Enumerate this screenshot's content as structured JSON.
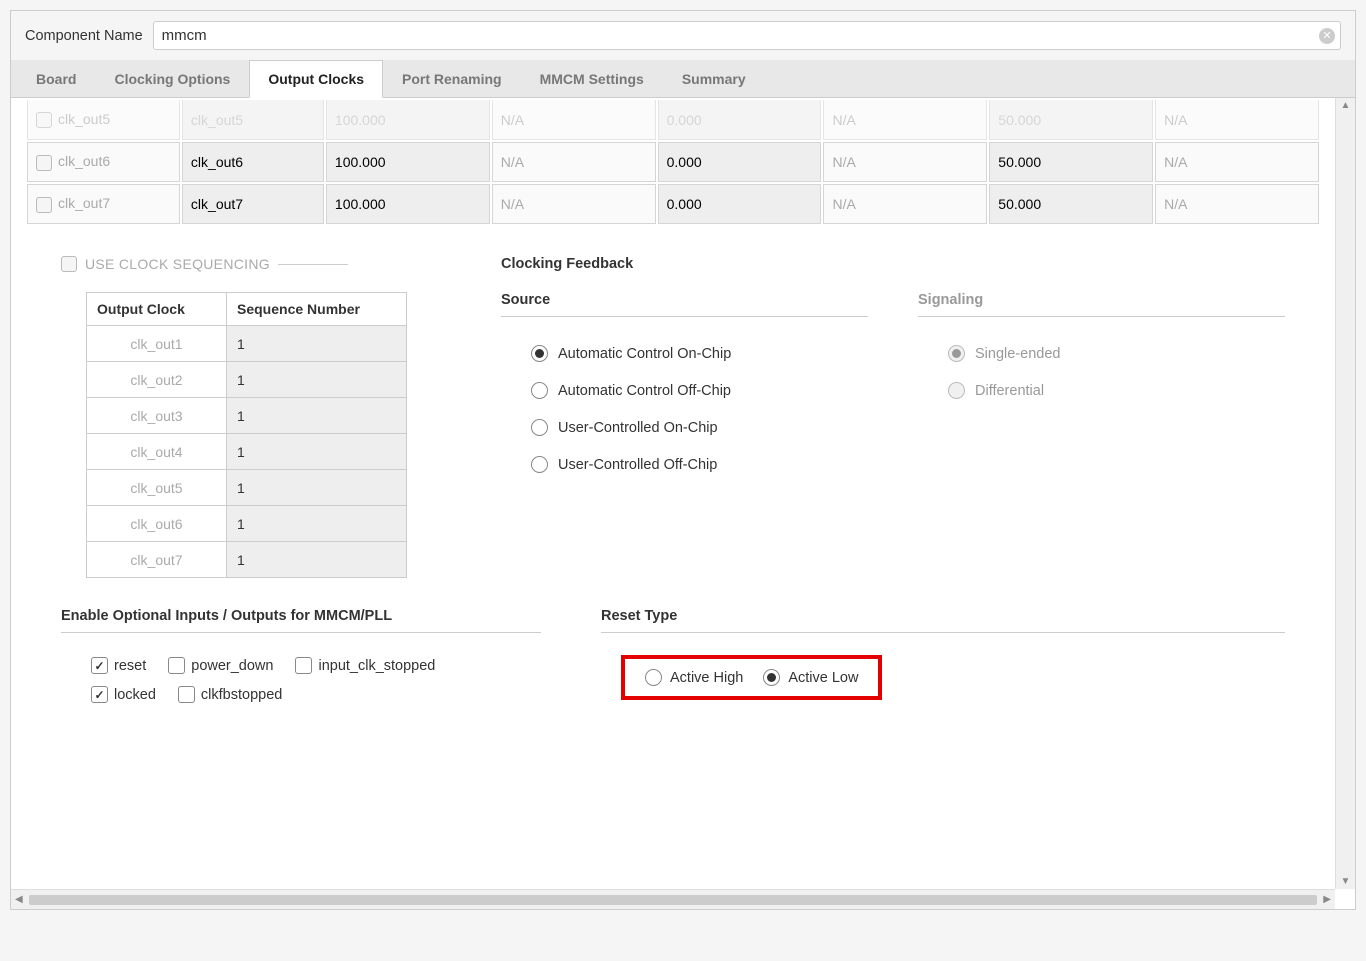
{
  "componentNameLabel": "Component Name",
  "componentName": "mmcm",
  "tabs": [
    "Board",
    "Clocking Options",
    "Output Clocks",
    "Port Renaming",
    "MMCM Settings",
    "Summary"
  ],
  "activeTabIndex": 2,
  "clockRows": [
    {
      "enabled": false,
      "nameLabel": "clk_out5",
      "portName": "clk_out5",
      "freq": "100.000",
      "freqActual": "N/A",
      "phase": "0.000",
      "phaseActual": "N/A",
      "duty": "50.000",
      "dutyActual": "N/A",
      "cut": true
    },
    {
      "enabled": false,
      "nameLabel": "clk_out6",
      "portName": "clk_out6",
      "freq": "100.000",
      "freqActual": "N/A",
      "phase": "0.000",
      "phaseActual": "N/A",
      "duty": "50.000",
      "dutyActual": "N/A",
      "cut": false
    },
    {
      "enabled": false,
      "nameLabel": "clk_out7",
      "portName": "clk_out7",
      "freq": "100.000",
      "freqActual": "N/A",
      "phase": "0.000",
      "phaseActual": "N/A",
      "duty": "50.000",
      "dutyActual": "N/A",
      "cut": false
    }
  ],
  "useClockSeqLabel": "USE CLOCK SEQUENCING",
  "seqTable": {
    "headers": [
      "Output Clock",
      "Sequence Number"
    ],
    "rows": [
      {
        "oc": "clk_out1",
        "sn": "1"
      },
      {
        "oc": "clk_out2",
        "sn": "1"
      },
      {
        "oc": "clk_out3",
        "sn": "1"
      },
      {
        "oc": "clk_out4",
        "sn": "1"
      },
      {
        "oc": "clk_out5",
        "sn": "1"
      },
      {
        "oc": "clk_out6",
        "sn": "1"
      },
      {
        "oc": "clk_out7",
        "sn": "1"
      }
    ]
  },
  "feedbackTitle": "Clocking Feedback",
  "sourceTitle": "Source",
  "signalingTitle": "Signaling",
  "sourceOptions": [
    {
      "label": "Automatic Control On-Chip",
      "checked": true
    },
    {
      "label": "Automatic Control Off-Chip",
      "checked": false
    },
    {
      "label": "User-Controlled On-Chip",
      "checked": false
    },
    {
      "label": "User-Controlled Off-Chip",
      "checked": false
    }
  ],
  "signalingOptions": [
    {
      "label": "Single-ended",
      "checked": true,
      "disabled": true
    },
    {
      "label": "Differential",
      "checked": false,
      "disabled": true
    }
  ],
  "optTitle": "Enable Optional Inputs / Outputs for MMCM/PLL",
  "optRow1": [
    {
      "label": "reset",
      "checked": true
    },
    {
      "label": "power_down",
      "checked": false
    },
    {
      "label": "input_clk_stopped",
      "checked": false
    }
  ],
  "optRow2": [
    {
      "label": "locked",
      "checked": true
    },
    {
      "label": "clkfbstopped",
      "checked": false
    }
  ],
  "resetTitle": "Reset Type",
  "resetOptions": [
    {
      "label": "Active High",
      "checked": false
    },
    {
      "label": "Active Low",
      "checked": true
    }
  ]
}
